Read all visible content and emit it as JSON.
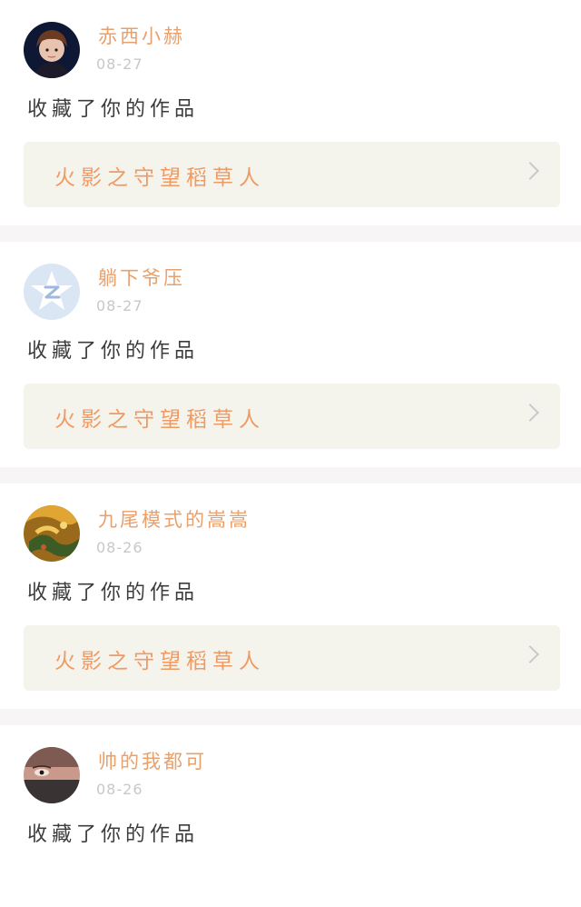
{
  "notifications": [
    {
      "username": "赤西小赫",
      "date": "08-27",
      "action": "收藏了你的作品",
      "work_title": "火影之守望稻草人",
      "avatar": "photo-avatar-boy"
    },
    {
      "username": "躺下爷压",
      "date": "08-27",
      "action": "收藏了你的作品",
      "work_title": "火影之守望稻草人",
      "avatar": "default-star-avatar"
    },
    {
      "username": "九尾模式的嵩嵩",
      "date": "08-26",
      "action": "收藏了你的作品",
      "work_title": "火影之守望稻草人",
      "avatar": "anime-orange-avatar"
    },
    {
      "username": "帅的我都可",
      "date": "08-26",
      "action": "收藏了你的作品",
      "avatar": "anime-masked-avatar"
    }
  ],
  "colors": {
    "username": "#e8a06d",
    "work_title": "#ef9a63",
    "date": "#c8c8c8",
    "card_bg": "#f4f3ec",
    "page_bg": "#f7f5f5"
  },
  "icons": {
    "chevron": "chevron-right-icon"
  }
}
